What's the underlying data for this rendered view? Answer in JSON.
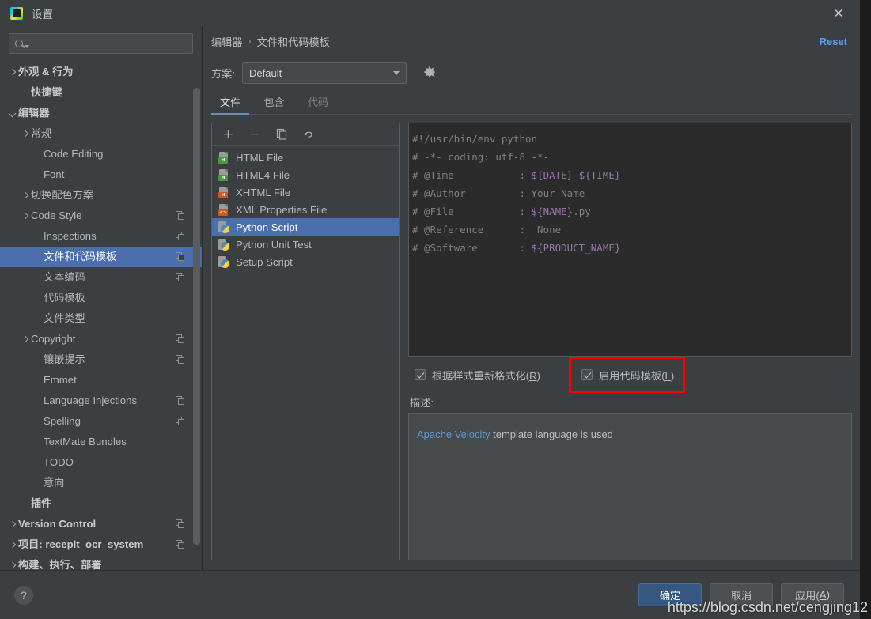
{
  "window": {
    "title": "设置",
    "app_icon": "pycharm-icon",
    "close_icon": "✕"
  },
  "sidebar": {
    "search": {
      "value": "",
      "placeholder": ""
    },
    "items": [
      {
        "label": "外观 & 行为",
        "indent": 0,
        "chev": "right",
        "bold": true,
        "badge": false,
        "selected": false
      },
      {
        "label": "快捷键",
        "indent": 1,
        "chev": "",
        "bold": true,
        "badge": false,
        "selected": false
      },
      {
        "label": "编辑器",
        "indent": 0,
        "chev": "down",
        "bold": true,
        "badge": false,
        "selected": false
      },
      {
        "label": "常规",
        "indent": 1,
        "chev": "right",
        "bold": false,
        "badge": false,
        "selected": false
      },
      {
        "label": "Code Editing",
        "indent": 2,
        "chev": "",
        "bold": false,
        "badge": false,
        "selected": false
      },
      {
        "label": "Font",
        "indent": 2,
        "chev": "",
        "bold": false,
        "badge": false,
        "selected": false
      },
      {
        "label": "切换配色方案",
        "indent": 1,
        "chev": "right",
        "bold": false,
        "badge": false,
        "selected": false
      },
      {
        "label": "Code Style",
        "indent": 1,
        "chev": "right",
        "bold": false,
        "badge": true,
        "selected": false
      },
      {
        "label": "Inspections",
        "indent": 2,
        "chev": "",
        "bold": false,
        "badge": true,
        "selected": false
      },
      {
        "label": "文件和代码模板",
        "indent": 2,
        "chev": "",
        "bold": false,
        "badge": true,
        "selected": true
      },
      {
        "label": "文本编码",
        "indent": 2,
        "chev": "",
        "bold": false,
        "badge": true,
        "selected": false
      },
      {
        "label": "代码模板",
        "indent": 2,
        "chev": "",
        "bold": false,
        "badge": false,
        "selected": false
      },
      {
        "label": "文件类型",
        "indent": 2,
        "chev": "",
        "bold": false,
        "badge": false,
        "selected": false
      },
      {
        "label": "Copyright",
        "indent": 1,
        "chev": "right",
        "bold": false,
        "badge": true,
        "selected": false
      },
      {
        "label": "镶嵌提示",
        "indent": 2,
        "chev": "",
        "bold": false,
        "badge": true,
        "selected": false
      },
      {
        "label": "Emmet",
        "indent": 2,
        "chev": "",
        "bold": false,
        "badge": false,
        "selected": false
      },
      {
        "label": "Language Injections",
        "indent": 2,
        "chev": "",
        "bold": false,
        "badge": true,
        "selected": false
      },
      {
        "label": "Spelling",
        "indent": 2,
        "chev": "",
        "bold": false,
        "badge": true,
        "selected": false
      },
      {
        "label": "TextMate Bundles",
        "indent": 2,
        "chev": "",
        "bold": false,
        "badge": false,
        "selected": false
      },
      {
        "label": "TODO",
        "indent": 2,
        "chev": "",
        "bold": false,
        "badge": false,
        "selected": false
      },
      {
        "label": "意向",
        "indent": 2,
        "chev": "",
        "bold": false,
        "badge": false,
        "selected": false
      },
      {
        "label": "插件",
        "indent": 1,
        "chev": "",
        "bold": true,
        "badge": false,
        "selected": false
      },
      {
        "label": "Version Control",
        "indent": 0,
        "chev": "right",
        "bold": true,
        "badge": true,
        "selected": false
      },
      {
        "label": "项目: recepit_ocr_system",
        "indent": 0,
        "chev": "right",
        "bold": true,
        "badge": true,
        "selected": false
      },
      {
        "label": "构建、执行、部署",
        "indent": 0,
        "chev": "right",
        "bold": true,
        "badge": false,
        "selected": false
      }
    ]
  },
  "main": {
    "breadcrumb": {
      "parent": "编辑器",
      "separator": "›",
      "current": "文件和代码模板"
    },
    "reset_label": "Reset",
    "scheme": {
      "label": "方案:",
      "value": "Default",
      "gear_icon": "gear-icon"
    },
    "tabs": [
      {
        "label": "文件",
        "active": true,
        "dim": false
      },
      {
        "label": "包含",
        "active": false,
        "dim": false
      },
      {
        "label": "代码",
        "active": false,
        "dim": true
      }
    ],
    "toolbar": {
      "add_label": "+",
      "remove_label": "−",
      "copy_label": "copy-icon",
      "revert_label": "revert-icon"
    },
    "templates": [
      {
        "name": "HTML File",
        "icon": "html-file-icon",
        "tag": "H",
        "tag_color": "green",
        "selected": false
      },
      {
        "name": "HTML4 File",
        "icon": "html4-file-icon",
        "tag": "H",
        "tag_color": "green",
        "selected": false
      },
      {
        "name": "XHTML File",
        "icon": "xhtml-file-icon",
        "tag": "H",
        "tag_color": "orange",
        "selected": false
      },
      {
        "name": "XML Properties File",
        "icon": "xml-file-icon",
        "tag": "<>",
        "tag_color": "xml",
        "selected": false
      },
      {
        "name": "Python Script",
        "icon": "python-file-icon",
        "tag": "",
        "tag_color": "",
        "selected": true
      },
      {
        "name": "Python Unit Test",
        "icon": "python-file-icon",
        "tag": "",
        "tag_color": "",
        "selected": false
      },
      {
        "name": "Setup Script",
        "icon": "python-file-icon",
        "tag": "",
        "tag_color": "",
        "selected": false
      }
    ],
    "code_lines": [
      [
        {
          "t": "#!/usr/bin/env python",
          "c": "txt"
        }
      ],
      [
        {
          "t": "# -*- coding: utf-8 -*-",
          "c": "txt"
        }
      ],
      [
        {
          "t": "# @Time           : ",
          "c": "txt"
        },
        {
          "t": "${DATE} ${TIME}",
          "c": "var"
        }
      ],
      [
        {
          "t": "# @Author         : ",
          "c": "txt"
        },
        {
          "t": "Your Name",
          "c": "txt"
        }
      ],
      [
        {
          "t": "# @File           : ",
          "c": "txt"
        },
        {
          "t": "${NAME}",
          "c": "var"
        },
        {
          "t": ".py",
          "c": "txt"
        }
      ],
      [
        {
          "t": "# @Reference      :  None",
          "c": "txt"
        }
      ],
      [
        {
          "t": "# @Software       : ",
          "c": "txt"
        },
        {
          "t": "${PRODUCT_NAME}",
          "c": "var"
        }
      ]
    ],
    "checkboxes": [
      {
        "label_pre": "根据样式重新格式化(",
        "mnemonic": "R",
        "label_post": ")",
        "checked": true,
        "highlighted": false
      },
      {
        "label_pre": "启用代码模板(",
        "mnemonic": "L",
        "label_post": ")",
        "checked": true,
        "highlighted": true
      }
    ],
    "highlight_color": "#fe0000",
    "description": {
      "label": "描述:",
      "link_text": "Apache Velocity",
      "rest_text": " template language is used"
    }
  },
  "footer": {
    "help_label": "?",
    "buttons": [
      {
        "label": "确定",
        "primary": true,
        "mnemonic": ""
      },
      {
        "label": "取消",
        "primary": false,
        "mnemonic": ""
      },
      {
        "label_pre": "应用(",
        "mnemonic": "A",
        "label_post": ")",
        "label": "应用(A)",
        "primary": false
      }
    ]
  },
  "watermark": "https://blog.csdn.net/cengjing12"
}
